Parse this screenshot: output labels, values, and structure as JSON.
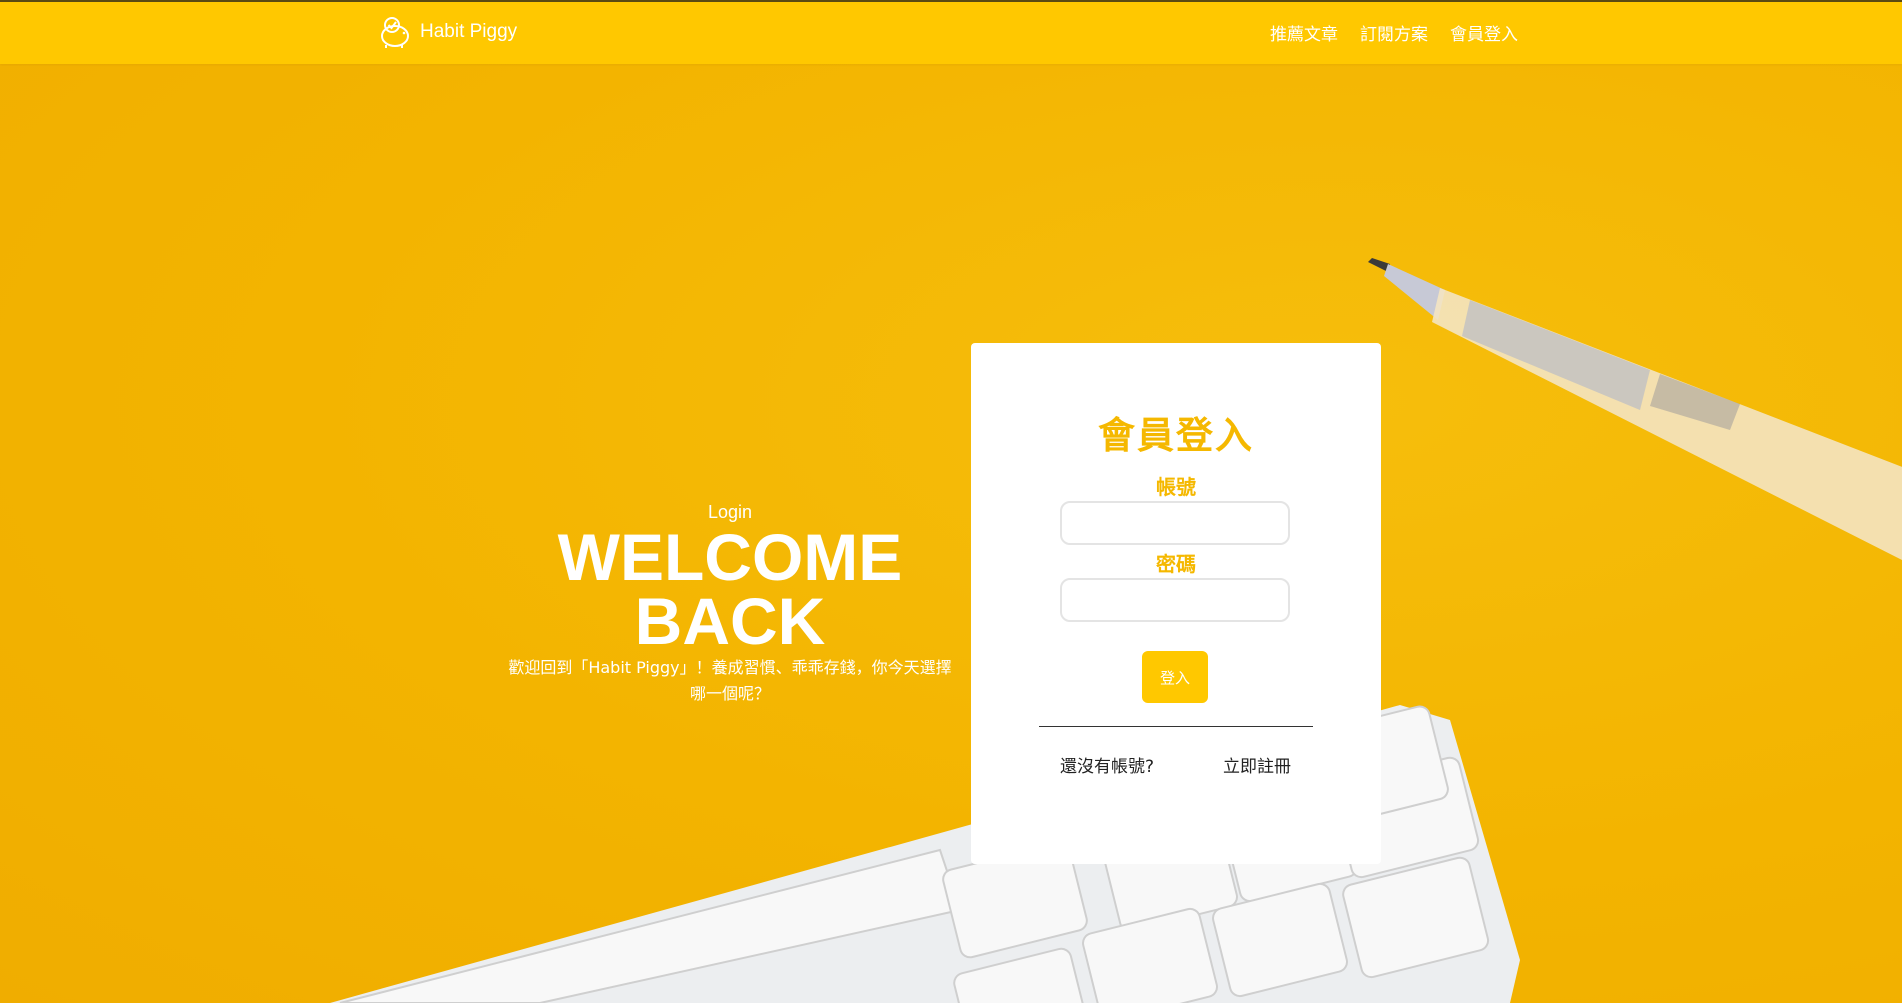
{
  "navbar": {
    "brand": "Habit Piggy",
    "links": [
      "推薦文章",
      "訂閱方案",
      "會員登入"
    ]
  },
  "hero": {
    "subtitle": "Login",
    "title": "WELCOME\nBACK",
    "description": "歡迎回到「Habit Piggy」！養成習慣、乖乖存錢，你今天選擇哪一個呢？"
  },
  "login_card": {
    "title": "會員登入",
    "account_label": "帳號",
    "account_value": "",
    "password_label": "密碼",
    "password_value": "",
    "submit_label": "登入",
    "no_account_text": "還沒有帳號?",
    "register_link": "立即註冊"
  },
  "colors": {
    "primary": "#ffc800",
    "background": "#f5b800",
    "accent_text": "#f5b800"
  }
}
